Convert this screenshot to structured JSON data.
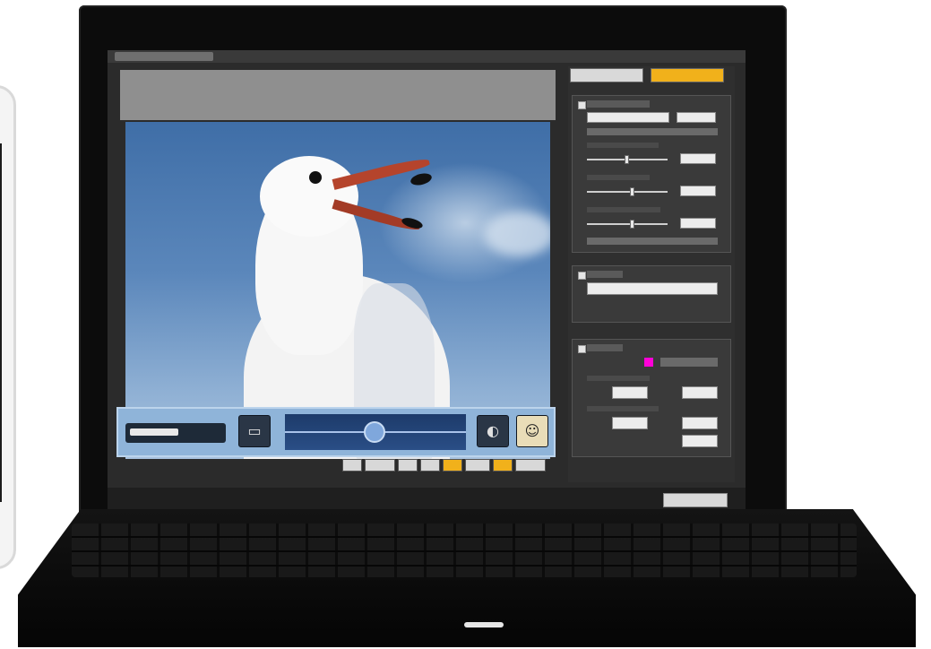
{
  "app": {
    "title": "",
    "top_buttons": [
      "",
      ""
    ],
    "close_label": ""
  },
  "preview": {
    "subject_icon": "gull-photo",
    "toolbar_icons": [
      "brightness-icon",
      "contrast-icon",
      "face-icon"
    ],
    "tool_buttons": [
      {
        "label": "",
        "style": "normal"
      },
      {
        "label": "",
        "style": "normal"
      },
      {
        "label": "",
        "style": "normal"
      },
      {
        "label": "",
        "style": "normal"
      },
      {
        "label": "",
        "style": "orange"
      },
      {
        "label": "",
        "style": "normal"
      },
      {
        "label": "",
        "style": "orange"
      },
      {
        "label": "",
        "style": "normal"
      }
    ]
  },
  "panel": {
    "sections": [
      "",
      "",
      ""
    ],
    "accent_color": "#f1b11b",
    "marker_color": "#ff00d8"
  }
}
